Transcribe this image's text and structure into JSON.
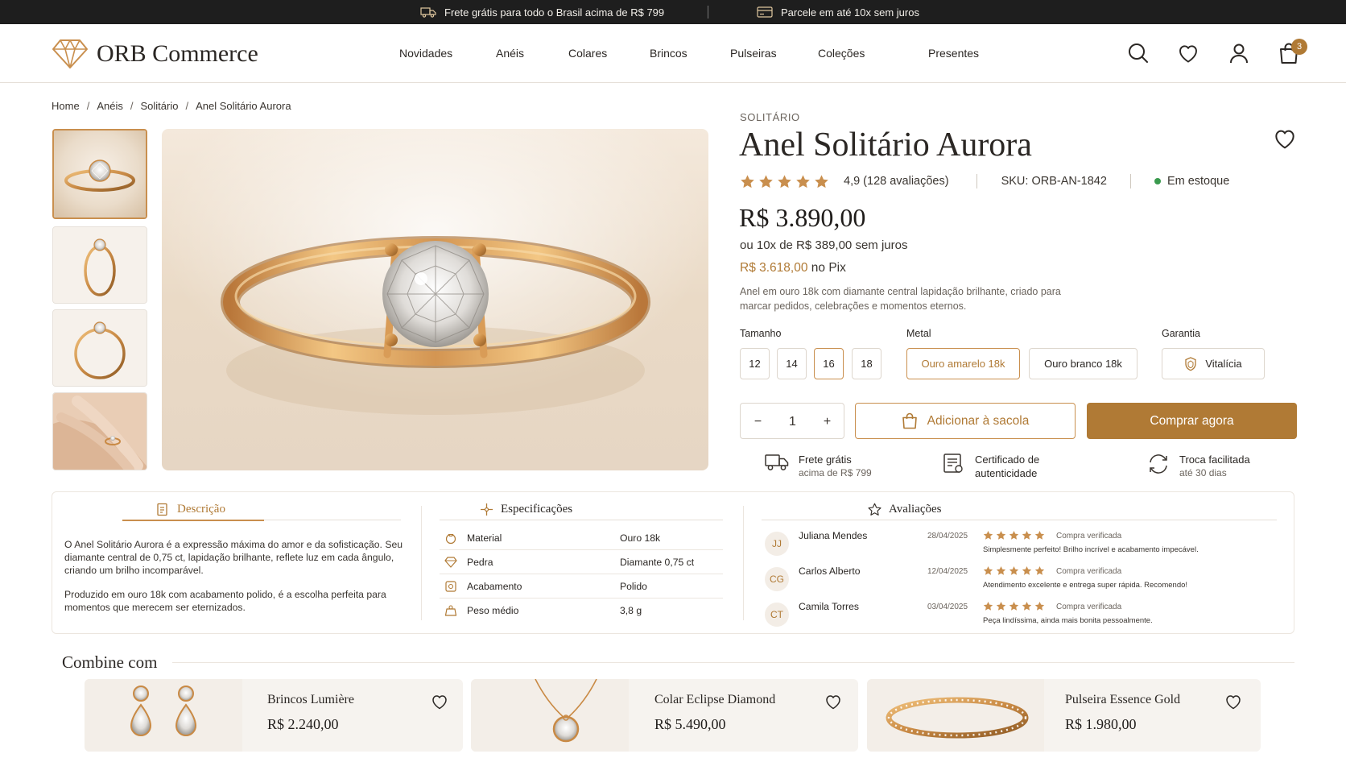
{
  "topbar": {
    "shipping_text": "Frete grátis para todo o Brasil acima de R$ 799",
    "installments_text": "Parcele em até 10x sem juros"
  },
  "header": {
    "logo_text": "ORB Commerce",
    "nav": [
      "Novidades",
      "Anéis",
      "Colares",
      "Brincos",
      "Pulseiras",
      "Coleções",
      "Presentes"
    ],
    "cart_count": "3"
  },
  "breadcrumb": [
    "Home",
    "Anéis",
    "Solitário",
    "Anel Solitário Aurora"
  ],
  "product": {
    "category": "SOLITÁRIO",
    "name": "Anel Solitário Aurora",
    "rating_value": 4.9,
    "rating_text": "4,9 (128 avaliações)",
    "sku": "SKU: ORB-AN-1842",
    "stock": "Em estoque",
    "price": "R$ 3.890,00",
    "installments": "ou 10x de R$ 389,00 sem juros",
    "pix_price": "R$ 3.618,00",
    "pix_suffix": "no Pix",
    "short_description": "Anel em ouro 18k com diamante central lapidação brilhante, criado para marcar pedidos, celebrações e momentos eternos."
  },
  "options": {
    "size_label": "Tamanho",
    "sizes": [
      "12",
      "14",
      "16",
      "18"
    ],
    "selected_size": "16",
    "metal_label": "Metal",
    "metals": [
      "Ouro amarelo 18k",
      "Ouro branco 18k"
    ],
    "selected_metal": "Ouro amarelo 18k",
    "warranty_label": "Garantia",
    "warranty": "Vitalícia"
  },
  "purchase": {
    "quantity": "1",
    "minus": "−",
    "plus": "+",
    "add_to_bag": "Adicionar à sacola",
    "buy_now": "Comprar agora"
  },
  "benefits": [
    {
      "title": "Frete grátis",
      "subtitle": "acima de R$ 799",
      "icon": "truck-icon"
    },
    {
      "title": "Certificado de",
      "subtitle": "autenticidade",
      "icon": "certificate-icon"
    },
    {
      "title": "Troca facilitada",
      "subtitle": "até 30 dias",
      "icon": "exchange-icon"
    }
  ],
  "tabs": {
    "description": "Descrição",
    "specifications": "Especificações",
    "reviews": "Avaliações"
  },
  "description": {
    "p1": "O Anel Solitário Aurora é a expressão máxima do amor e da sofisticação. Seu diamante central de 0,75 ct, lapidação brilhante, reflete luz em cada ângulo, criando um brilho incomparável.",
    "p2": "Produzido em ouro 18k com acabamento polido, é a escolha perfeita para momentos que merecem ser eternizados."
  },
  "specifications": [
    {
      "label": "Material",
      "value": "Ouro 18k"
    },
    {
      "label": "Pedra",
      "value": "Diamante 0,75 ct"
    },
    {
      "label": "Acabamento",
      "value": "Polido"
    },
    {
      "label": "Peso médio",
      "value": "3,8 g"
    }
  ],
  "reviews": [
    {
      "initials": "JJ",
      "name": "Juliana Mendes",
      "date": "28/04/2025",
      "stars": 5,
      "verified": "Compra verificada",
      "text": "Simplesmente perfeito! Brilho incrível e acabamento impecável."
    },
    {
      "initials": "CG",
      "name": "Carlos Alberto",
      "date": "12/04/2025",
      "stars": 5,
      "verified": "Compra verificada",
      "text": "Atendimento excelente e entrega super rápida. Recomendo!"
    },
    {
      "initials": "CT",
      "name": "Camila Torres",
      "date": "03/04/2025",
      "stars": 5,
      "verified": "Compra verificada",
      "text": "Peça lindíssima, ainda mais bonita pessoalmente."
    }
  ],
  "combine": {
    "title": "Combine com",
    "items": [
      {
        "name": "Brincos Lumière",
        "price": "R$ 2.240,00"
      },
      {
        "name": "Colar Eclipse Diamond",
        "price": "R$ 5.490,00"
      },
      {
        "name": "Pulseira Essence Gold",
        "price": "R$ 1.980,00"
      }
    ]
  },
  "colors": {
    "accent": "#b07a35",
    "accent_border": "#c98f4e",
    "topbar": "#1e1e1e",
    "stock": "#3a9a4e",
    "star": "#c98f4e"
  }
}
